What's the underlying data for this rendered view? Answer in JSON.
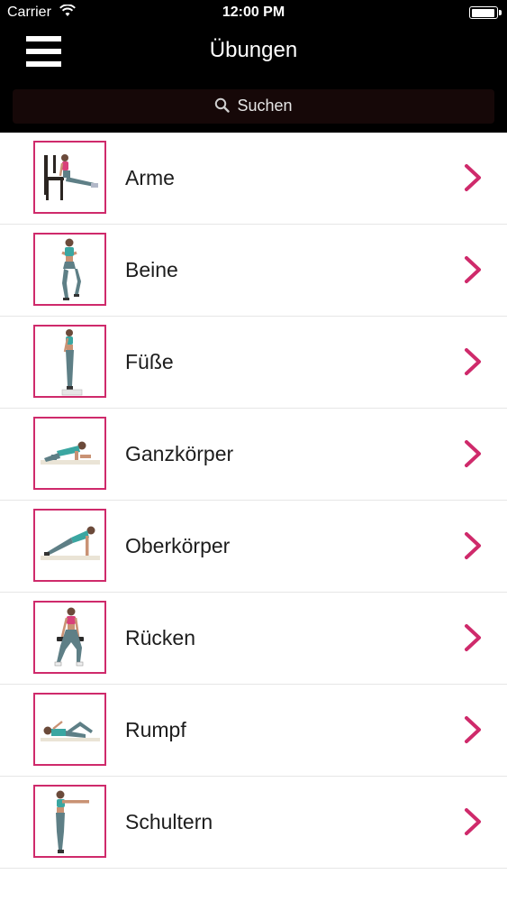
{
  "status_bar": {
    "carrier": "Carrier",
    "time": "12:00 PM",
    "battery_level": 0.85
  },
  "nav": {
    "title": "Übungen",
    "menu_icon": "hamburger-menu-icon"
  },
  "search": {
    "placeholder": "Suchen",
    "icon": "search-icon"
  },
  "colors": {
    "accent": "#cf2a6b",
    "header_bg": "#000000",
    "search_bg": "#160808"
  },
  "list": {
    "items": [
      {
        "label": "Arme",
        "thumb_icon": "arm-exercise-chair-dip-icon"
      },
      {
        "label": "Beine",
        "thumb_icon": "leg-exercise-lunge-icon"
      },
      {
        "label": "Füße",
        "thumb_icon": "foot-exercise-calf-raise-icon"
      },
      {
        "label": "Ganzkörper",
        "thumb_icon": "full-body-exercise-plank-icon"
      },
      {
        "label": "Oberkörper",
        "thumb_icon": "upper-body-exercise-pushup-icon"
      },
      {
        "label": "Rücken",
        "thumb_icon": "back-exercise-dumbbell-row-icon"
      },
      {
        "label": "Rumpf",
        "thumb_icon": "core-exercise-side-lying-icon"
      },
      {
        "label": "Schultern",
        "thumb_icon": "shoulder-exercise-arm-raise-icon"
      }
    ]
  }
}
